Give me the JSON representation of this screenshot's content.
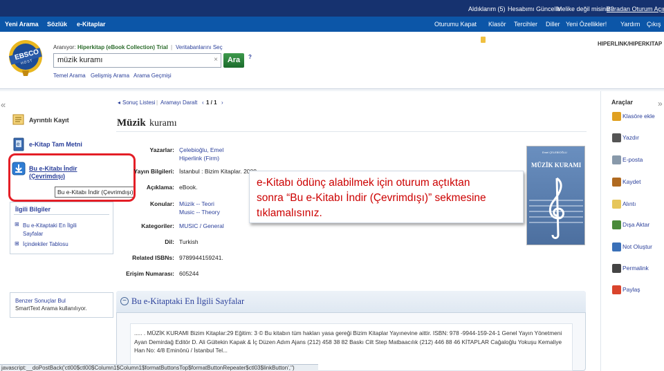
{
  "topbar": {
    "aldiklarim": "Aldıklarım (5)",
    "hesabimi_guncelle": "Hesabımı Güncelle",
    "melike_degil_misiniz": "Melike değil misiniz?",
    "buradan_oturum_acin": "Buradan Oturum Açın."
  },
  "navbar": {
    "left": [
      "Yeni Arama",
      "Sözlük",
      "e-Kitaplar"
    ],
    "right": [
      "Oturumu Kapat",
      "Klasör",
      "Tercihler",
      "Diller",
      "Yeni Özellikler!",
      "Yardım",
      "Çıkış"
    ]
  },
  "logo": {
    "text": "EBSCO",
    "sub": "HOST"
  },
  "search": {
    "searching_label": "Aranıyor:",
    "database": "Hiperkitap (eBook Collection) Trial",
    "choose_db": "Veritabanlarını Seç",
    "query": "müzik kuramı",
    "button": "Ara",
    "help": "?",
    "links": [
      "Temel Arama",
      "Gelişmiş Arama",
      "Arama Geçmişi"
    ],
    "institution": "HIPERLINK/HIPERKITAP"
  },
  "left_sidebar": {
    "collapse": "«",
    "items": [
      {
        "label": "Ayrıntılı Kayıt",
        "icon": "detailed-record-icon"
      },
      {
        "label": "e-Kitap Tam Metni",
        "icon": "ebook-icon"
      },
      {
        "label": "Bu e-Kitabı İndir (Çevrimdışı)",
        "icon": "download-icon"
      }
    ],
    "tooltip": "Bu e-Kitabı İndir (Çevrimdışı)",
    "related_title": "İlgili Bilgiler",
    "related_links": [
      "Bu e-Kitaptaki En İlgili Sayfalar",
      "İçindekiler Tablosu"
    ],
    "benzer_title": "Benzer Sonuçlar Bul",
    "benzer_text": "SmartText Arama kullanılıyor."
  },
  "breadcrumb": {
    "back": "Sonuç Listesi",
    "refine": "Aramayı Daralt",
    "paging": "1 / 1"
  },
  "record": {
    "title_bold": "Müzik",
    "title_rest": "kuramı",
    "fields": [
      {
        "label": "Yazarlar:",
        "values": [
          "Çelebioğlu, Emel",
          "Hiperlink (Firm)"
        ]
      },
      {
        "label": "Yayın Bilgileri:",
        "values": [
          "İstanbul : Bizim Kitaplar. 2008"
        ]
      },
      {
        "label": "Açıklama:",
        "values": [
          "eBook."
        ]
      },
      {
        "label": "Konular:",
        "values": [
          "Müzik -- Teori",
          "Music -- Theory"
        ]
      },
      {
        "label": "Kategoriler:",
        "values": [
          "MUSIC / General"
        ]
      },
      {
        "label": "Dil:",
        "values": [
          "Turkish"
        ]
      },
      {
        "label": "Related ISBNs:",
        "values": [
          "9789944159241."
        ]
      },
      {
        "label": "Erişim Numarası:",
        "values": [
          "605244"
        ]
      }
    ],
    "cover_author": "Emel ÇELEBİOĞLU",
    "cover_title": "MÜZİK KURAMI"
  },
  "callout": {
    "line1": "e-Kitabı ödünç alabilmek için oturum açtıktan",
    "line2": "sonra “Bu e-Kitabı İndir (Çevrimdışı)” sekmesine",
    "line3": "tıklamalısınız."
  },
  "pages_panel": {
    "title": "Bu e-Kitaptaki En İlgili Sayfalar",
    "toggle": "−",
    "snippet": "..... . MÜZİK KURAMI Bizim Kitaplar:29 Eğitim: 3 © Bu kitabın tüm hakları yasa gereği Bizim Kitaplar Yayınevine aittir. ISBN: 978 -9944-159-24-1 Genel Yayın Yönetmeni Ayan Demirdağ Editör D. Ali Gültekin Kapak & İç Düzen Adım Ajans (212) 458 38 82 Baskı Cilt Step Matbaacılık (212) 446 88 46 KİTAPLAR Cağaloğlu Yokuşu Kemaliye Han No: 4/8 Eminönü / İstanbul Tel..."
  },
  "tools": {
    "title": "Araçlar",
    "expand": "»",
    "items": [
      {
        "label": "Klasöre ekle",
        "icon": "folder-add-icon",
        "color": "#e0a020"
      },
      {
        "label": "Yazdır",
        "icon": "printer-icon",
        "color": "#555555"
      },
      {
        "label": "E-posta",
        "icon": "email-icon",
        "color": "#8899aa"
      },
      {
        "label": "Kaydet",
        "icon": "save-icon",
        "color": "#b06a20"
      },
      {
        "label": "Alıntı",
        "icon": "cite-icon",
        "color": "#e6c65a"
      },
      {
        "label": "Dışa Aktar",
        "icon": "export-icon",
        "color": "#4a8a3a"
      },
      {
        "label": "Not Oluştur",
        "icon": "note-icon",
        "color": "#3a70b8"
      },
      {
        "label": "Permalink",
        "icon": "permalink-icon",
        "color": "#444444"
      },
      {
        "label": "Paylaş",
        "icon": "share-icon",
        "color": "#d9442c"
      }
    ]
  },
  "status": "javascript:__doPostBack('ctl00$ctl00$Column1$Column1$formatButtonsTop$formatButtonRepeater$ctl03$linkButton','')"
}
